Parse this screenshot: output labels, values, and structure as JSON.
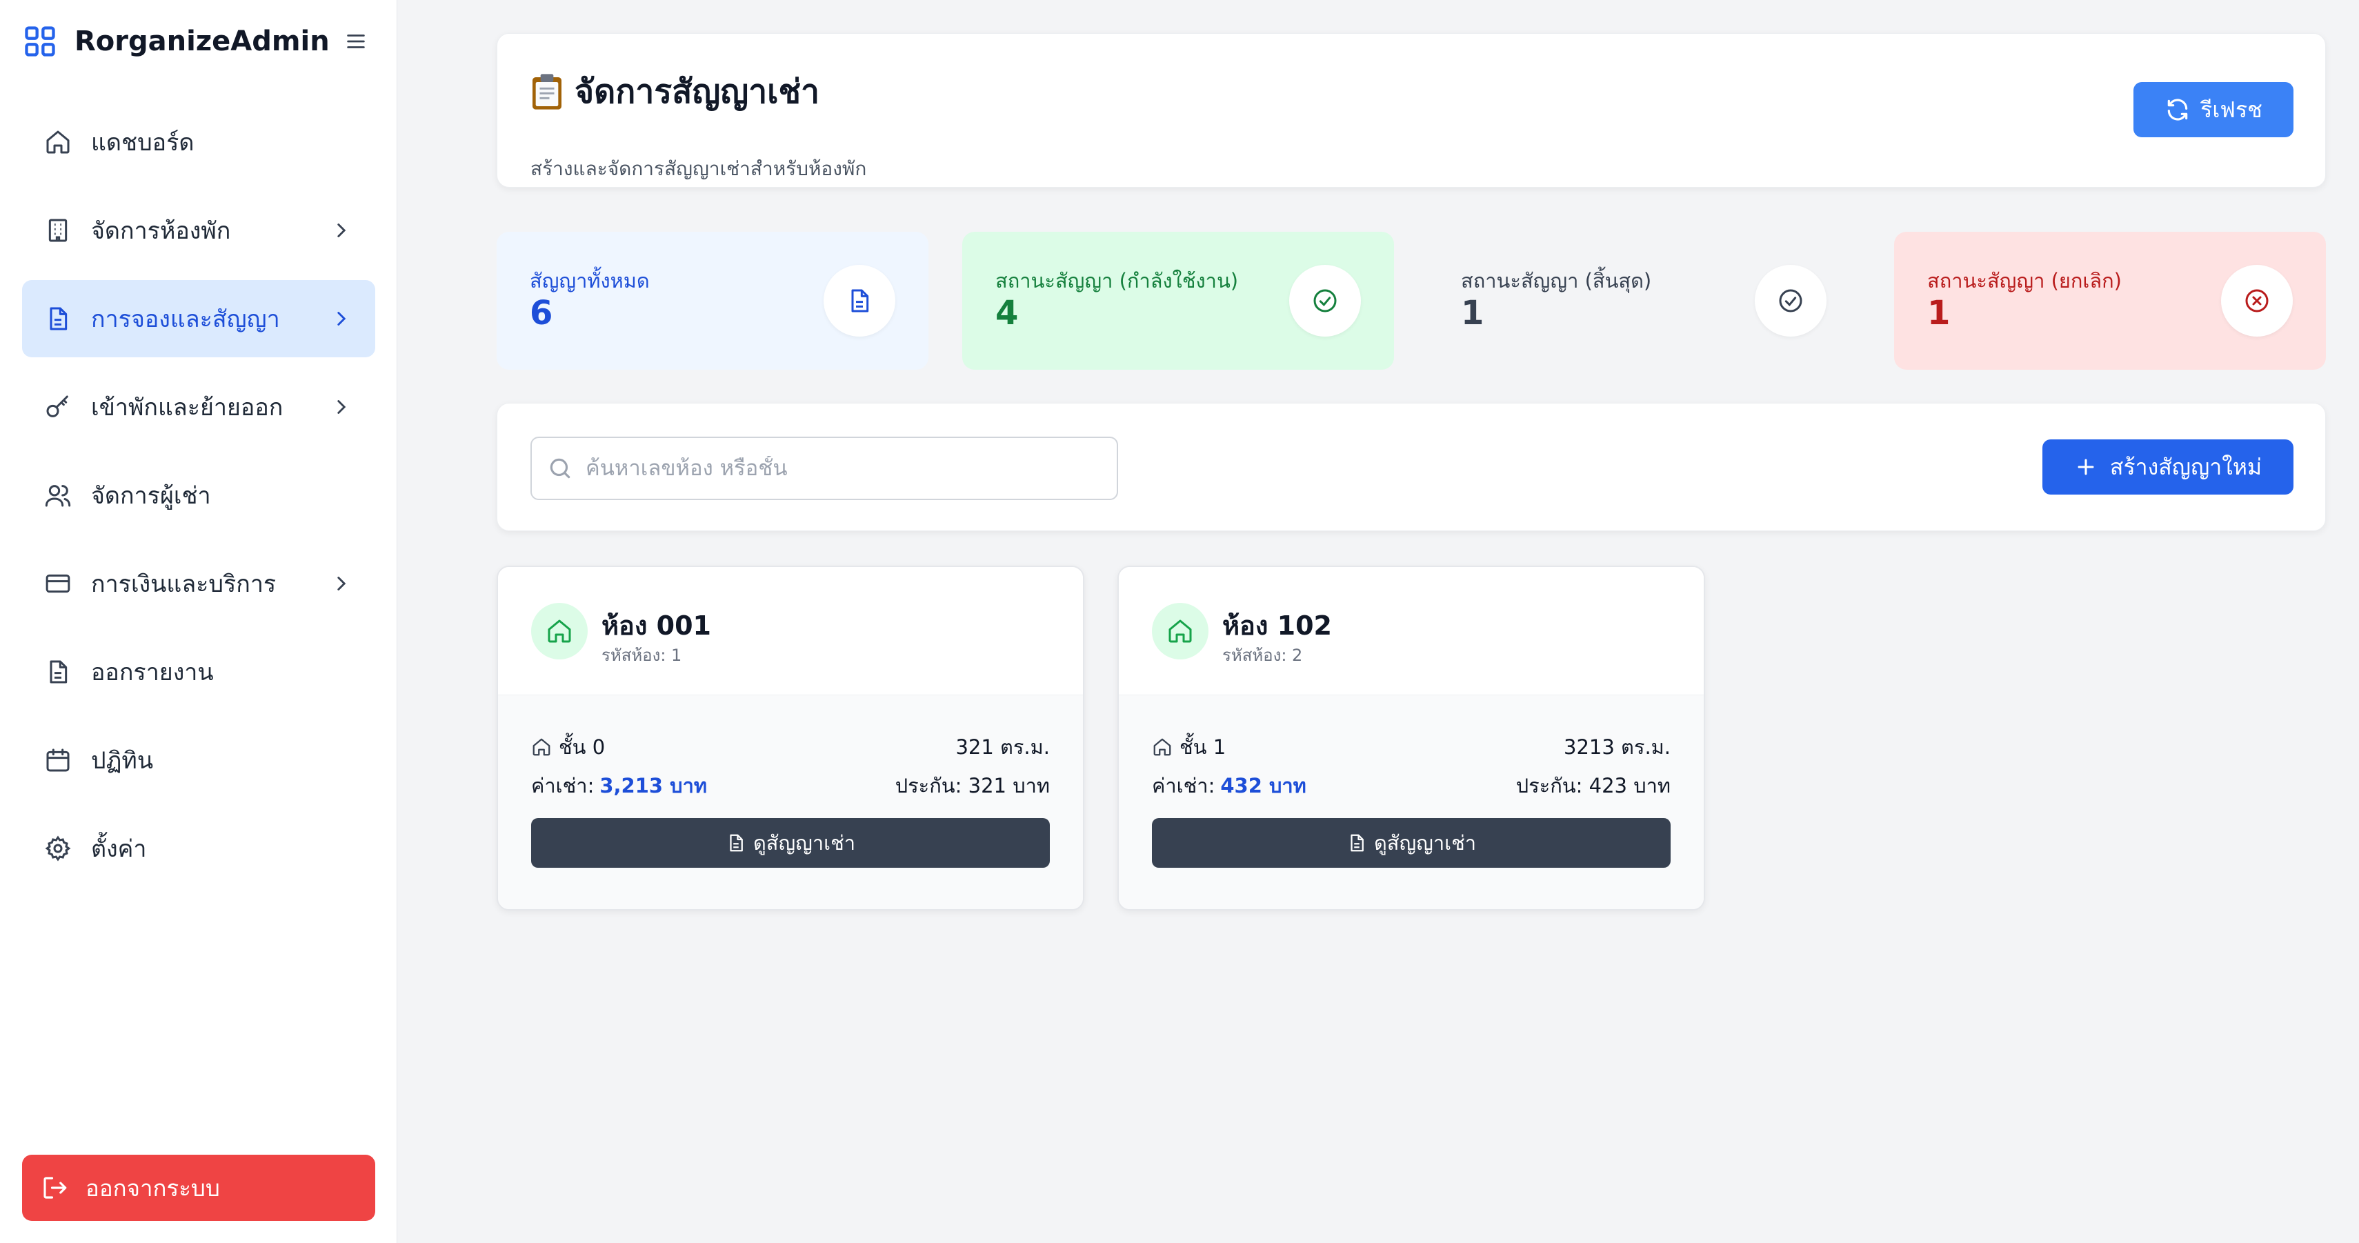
{
  "app": {
    "name": "RorganizeAdmin"
  },
  "sidebar": {
    "items": [
      {
        "label": "แดชบอร์ด",
        "icon": "home-icon",
        "has_chevron": false
      },
      {
        "label": "จัดการห้องพัก",
        "icon": "building-icon",
        "has_chevron": true
      },
      {
        "label": "การจองและสัญญา",
        "icon": "document-icon",
        "has_chevron": true,
        "active": true
      },
      {
        "label": "เข้าพักและย้ายออก",
        "icon": "key-icon",
        "has_chevron": true
      },
      {
        "label": "จัดการผู้เช่า",
        "icon": "users-icon",
        "has_chevron": false
      },
      {
        "label": "การเงินและบริการ",
        "icon": "credit-card-icon",
        "has_chevron": true
      },
      {
        "label": "ออกรายงาน",
        "icon": "report-icon",
        "has_chevron": false
      },
      {
        "label": "ปฏิทิน",
        "icon": "calendar-icon",
        "has_chevron": false
      },
      {
        "label": "ตั้งค่า",
        "icon": "gear-icon",
        "has_chevron": false
      }
    ],
    "logout_label": "ออกจากระบบ"
  },
  "header": {
    "title": "จัดการสัญญาเช่า",
    "subtitle": "สร้างและจัดการสัญญาเช่าสำหรับห้องพัก",
    "refresh_label": "รีเฟรช"
  },
  "stats": [
    {
      "label": "สัญญาทั้งหมด",
      "value": "6",
      "icon": "document-icon",
      "bg": "#eff6ff",
      "color": "#1d4ed8"
    },
    {
      "label": "สถานะสัญญา (กำลังใช้งาน)",
      "value": "4",
      "icon": "check-circle-icon",
      "bg": "#dcfce7",
      "color": "#15803d"
    },
    {
      "label": "สถานะสัญญา (สิ้นสุด)",
      "value": "1",
      "icon": "check-circle-icon",
      "bg": "#f3f4f6",
      "color": "#374151"
    },
    {
      "label": "สถานะสัญญา (ยกเลิก)",
      "value": "1",
      "icon": "x-circle-icon",
      "bg": "#fee2e2",
      "color": "#b91c1c"
    }
  ],
  "search": {
    "placeholder": "ค้นหาเลขห้อง หรือชั้น",
    "value": ""
  },
  "create_label": "สร้างสัญญาใหม่",
  "rooms": [
    {
      "name": "ห้อง 001",
      "code": "รหัสห้อง: 1",
      "floor": "ชั้น 0",
      "area": "321 ตร.ม.",
      "rent_label": "ค่าเช่า:",
      "rent_amount": "3,213 บาท",
      "deposit": "ประกัน: 321 บาท",
      "view_label": "ดูสัญญาเช่า"
    },
    {
      "name": "ห้อง 102",
      "code": "รหัสห้อง: 2",
      "floor": "ชั้น 1",
      "area": "3213 ตร.ม.",
      "rent_label": "ค่าเช่า:",
      "rent_amount": "432 บาท",
      "deposit": "ประกัน: 423 บาท",
      "view_label": "ดูสัญญาเช่า"
    }
  ],
  "colors": {
    "primary": "#2563eb",
    "refresh": "#3b82f6",
    "danger": "#ef4444",
    "active_bg": "#dbeafe",
    "dark_button": "#374151"
  }
}
